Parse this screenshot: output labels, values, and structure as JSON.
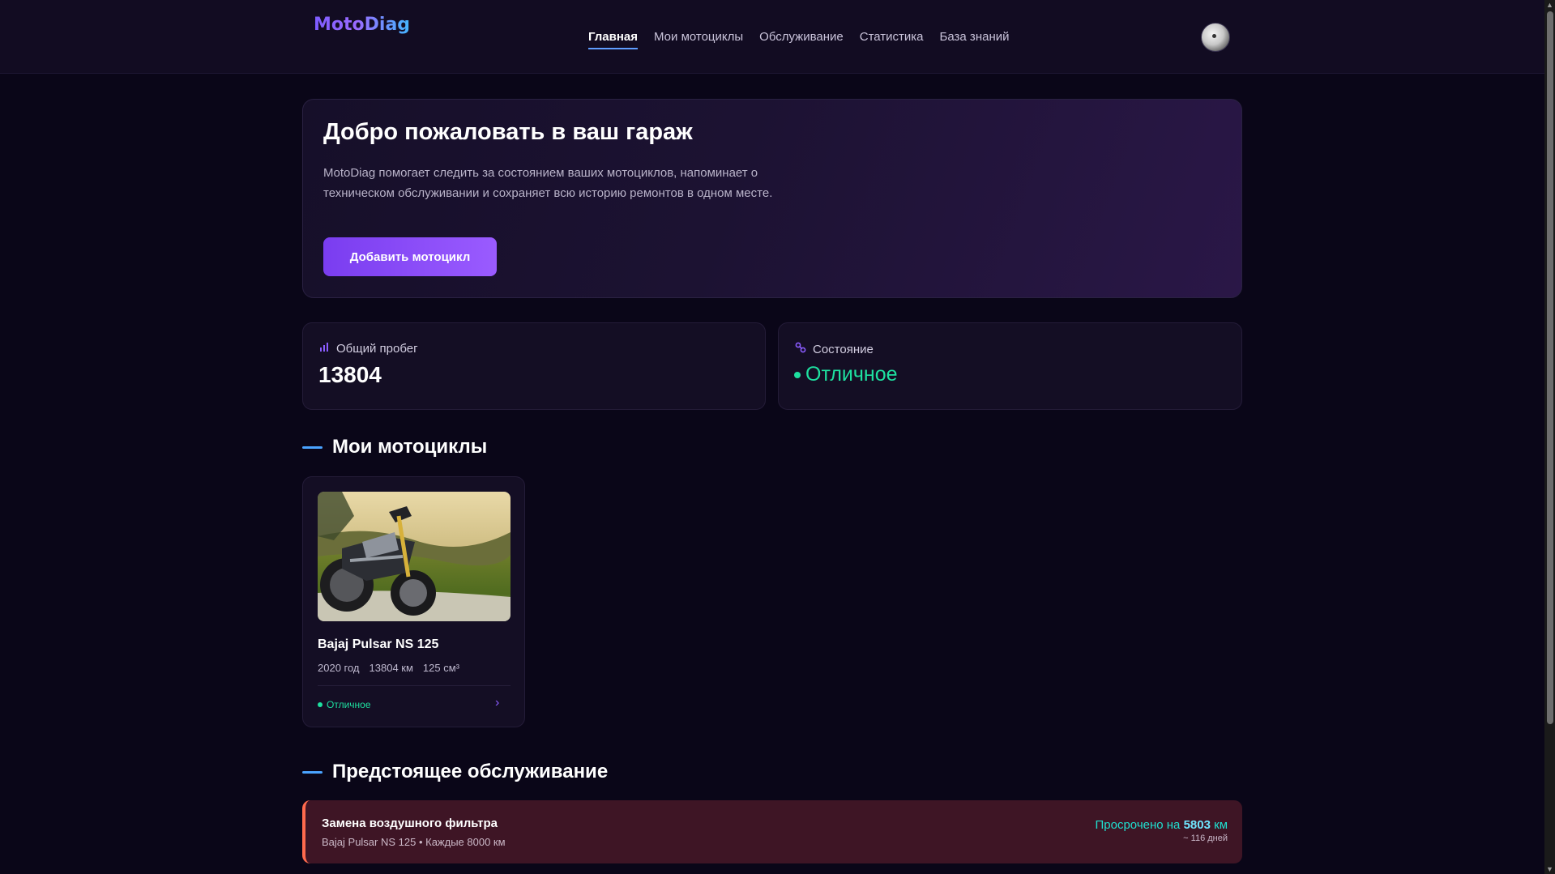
{
  "app": {
    "logo": "MotoDiag"
  },
  "nav": {
    "items": [
      {
        "label": "Главная",
        "active": true
      },
      {
        "label": "Мои мотоциклы"
      },
      {
        "label": "Обслуживание"
      },
      {
        "label": "Статистика"
      },
      {
        "label": "База знаний"
      }
    ]
  },
  "hero": {
    "title": "Добро пожаловать в ваш гараж",
    "text": "MotoDiag помогает следить за состоянием ваших мотоциклов, напоминает о техническом обслуживании и сохраняет всю историю ремонтов в одном месте.",
    "button": "Добавить мотоцикл"
  },
  "stats": {
    "mileage": {
      "label": "Общий пробег",
      "value": "13804",
      "icon": "bar-chart-icon"
    },
    "condition": {
      "label": "Состояние",
      "value": "Отличное",
      "icon": "wrench-link-icon",
      "color": "#1ee0a0"
    }
  },
  "motorcycles_section": {
    "title": "Мои мотоциклы"
  },
  "motorcycles": [
    {
      "name": "Bajaj Pulsar NS 125",
      "year": "2020 год",
      "mileage": "13804 км",
      "volume": "125 см³",
      "status": "Отличное"
    }
  ],
  "maintenance_section": {
    "title": "Предстоящее обслуживание"
  },
  "maintenance": [
    {
      "title": "Замена воздушного фильтра",
      "subtitle": "Bajaj Pulsar NS 125 • Каждые 8000 км",
      "overdue_prefix": "Просрочено на",
      "overdue_value": "5803",
      "overdue_unit": "км",
      "days": "~ 116 дней",
      "accent": "#ff6a4d"
    }
  ],
  "colors": {
    "accent": "#7a3df0",
    "success": "#1ee0a0",
    "link": "#4aa3ff"
  }
}
